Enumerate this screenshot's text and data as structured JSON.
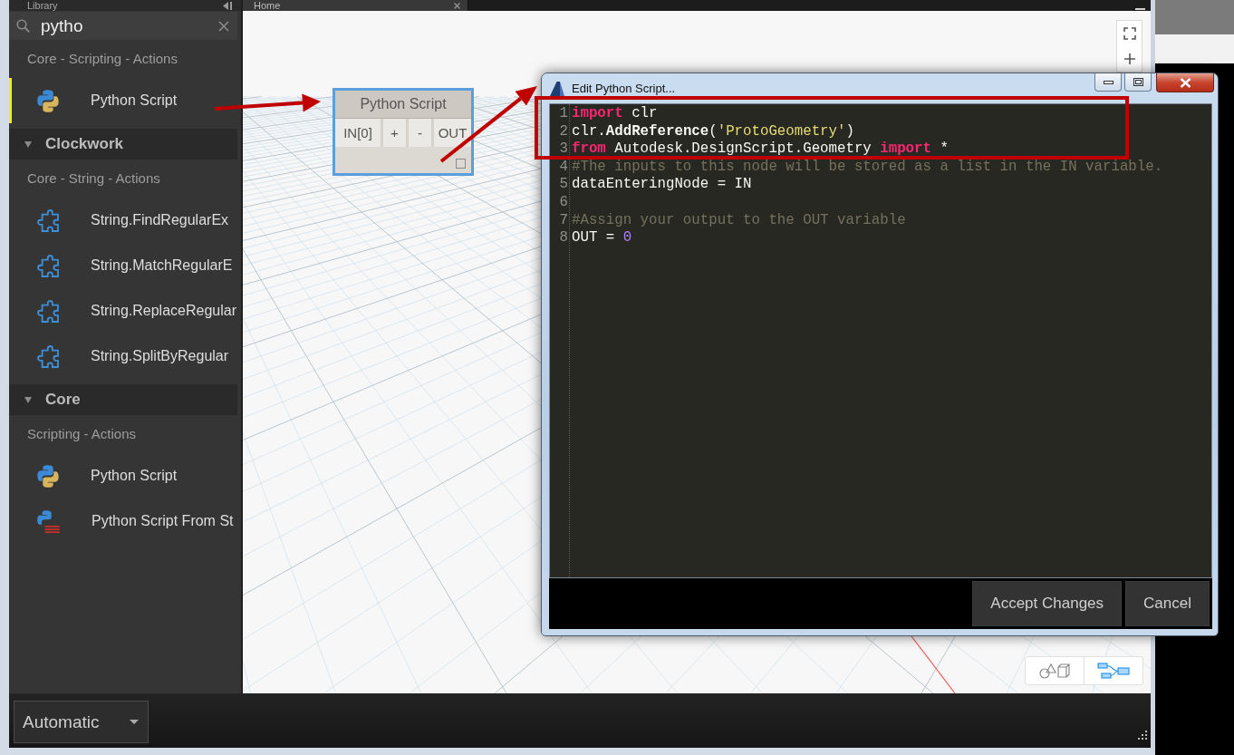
{
  "library": {
    "title": "Library",
    "search": {
      "value": "pytho"
    },
    "results": [
      {
        "kind": "category",
        "label": "Core - Scripting - Actions",
        "children": [
          {
            "kind": "python",
            "label": "Python Script",
            "selected": true
          }
        ]
      },
      {
        "kind": "group",
        "label": "Clockwork",
        "expanded": true,
        "children": [
          {
            "kind": "category",
            "label": "Core - String - Actions",
            "children": [
              {
                "kind": "custom",
                "label": "String.FindRegularEx",
                "selected": false
              },
              {
                "kind": "custom",
                "label": "String.MatchRegularE",
                "selected": false
              },
              {
                "kind": "custom",
                "label": "String.ReplaceRegular",
                "selected": false
              },
              {
                "kind": "custom",
                "label": "String.SplitByRegular",
                "selected": false
              }
            ]
          }
        ]
      },
      {
        "kind": "group",
        "label": "Core",
        "expanded": true,
        "children": [
          {
            "kind": "category",
            "label": "Scripting - Actions",
            "children": [
              {
                "kind": "python",
                "label": "Python Script",
                "selected": false
              },
              {
                "kind": "python-string",
                "label": "Python Script From St",
                "selected": false
              }
            ]
          }
        ]
      }
    ]
  },
  "workspace": {
    "tabs": [
      {
        "label": "Home",
        "selected": true
      }
    ],
    "node": {
      "title": "Python Script",
      "inputs": [
        "IN[0]"
      ],
      "port_buttons": [
        "+",
        "-"
      ],
      "outputs": [
        "OUT"
      ]
    },
    "view_toggle": [
      {
        "kind": "geometry",
        "selected": false
      },
      {
        "kind": "graph",
        "selected": true
      }
    ]
  },
  "dialog": {
    "title": "Edit Python Script...",
    "lines": [
      {
        "number": "1",
        "tokens": [
          {
            "kind": "keyword",
            "text": "import"
          },
          {
            "kind": "plain",
            "text": " clr"
          }
        ]
      },
      {
        "number": "2",
        "tokens": [
          {
            "kind": "plain",
            "text": "clr."
          },
          {
            "kind": "function",
            "text": "AddReference"
          },
          {
            "kind": "plain",
            "text": "("
          },
          {
            "kind": "string",
            "text": "'ProtoGeometry'"
          },
          {
            "kind": "plain",
            "text": ")"
          }
        ]
      },
      {
        "number": "3",
        "tokens": [
          {
            "kind": "keyword",
            "text": "from"
          },
          {
            "kind": "plain",
            "text": " Autodesk.DesignScript.Geometry "
          },
          {
            "kind": "keyword",
            "text": "import"
          },
          {
            "kind": "plain",
            "text": " *"
          }
        ]
      },
      {
        "number": "4",
        "tokens": [
          {
            "kind": "comment",
            "text": "#The inputs to this node will be stored as a list in the IN variable."
          }
        ]
      },
      {
        "number": "5",
        "tokens": [
          {
            "kind": "plain",
            "text": "dataEnteringNode = IN"
          }
        ]
      },
      {
        "number": "6"
      },
      {
        "number": "7",
        "tokens": [
          {
            "kind": "comment",
            "text": "#Assign your output to the OUT variable"
          }
        ]
      },
      {
        "number": "8",
        "tokens": [
          {
            "kind": "plain",
            "text": "OUT = "
          },
          {
            "kind": "number",
            "text": "0"
          }
        ]
      }
    ],
    "buttons": [
      "Accept Changes",
      "Cancel"
    ]
  },
  "bottom_bar": {
    "run_mode": "Automatic"
  },
  "annotations": [
    {
      "kind": "arrow"
    },
    {
      "kind": "arrow"
    },
    {
      "kind": "frame"
    }
  ]
}
